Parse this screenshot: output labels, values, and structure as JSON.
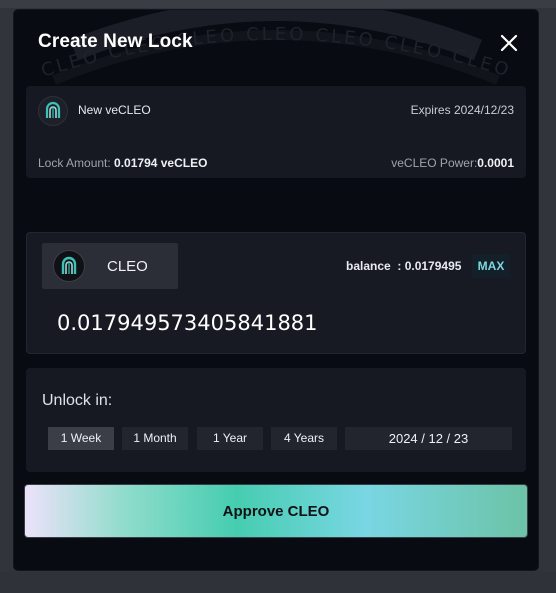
{
  "modal": {
    "title": "Create New Lock",
    "decoration_text": "CLEO CLEO CLEO CLEO CLEO CLEO CLEO"
  },
  "lock_info": {
    "name": "New veCLEO",
    "expires": "Expires 2024/12/23",
    "amount_label": "Lock Amount: ",
    "amount_value": "0.01794 veCLEO",
    "power_label": "veCLEO Power:",
    "power_value": "0.0001"
  },
  "token": {
    "symbol": "CLEO",
    "balance_label": "balance",
    "balance_separator": "  : ",
    "balance_value": "0.0179495",
    "max_label": "MAX",
    "amount": "0.017949573405841881"
  },
  "unlock": {
    "label": "Unlock in:",
    "options": [
      "1 Week",
      "1 Month",
      "1 Year",
      "4 Years"
    ],
    "selected": "1 Week",
    "date": "2024 / 12 / 23"
  },
  "approve_label": "Approve CLEO",
  "colors": {
    "modal_bg": "#090b12",
    "card_bg": "#171922",
    "accent": "#46cdb0",
    "max_text": "#7fd6dd"
  },
  "icons": {
    "close": "close-icon",
    "token": "cleo-logo-icon"
  }
}
